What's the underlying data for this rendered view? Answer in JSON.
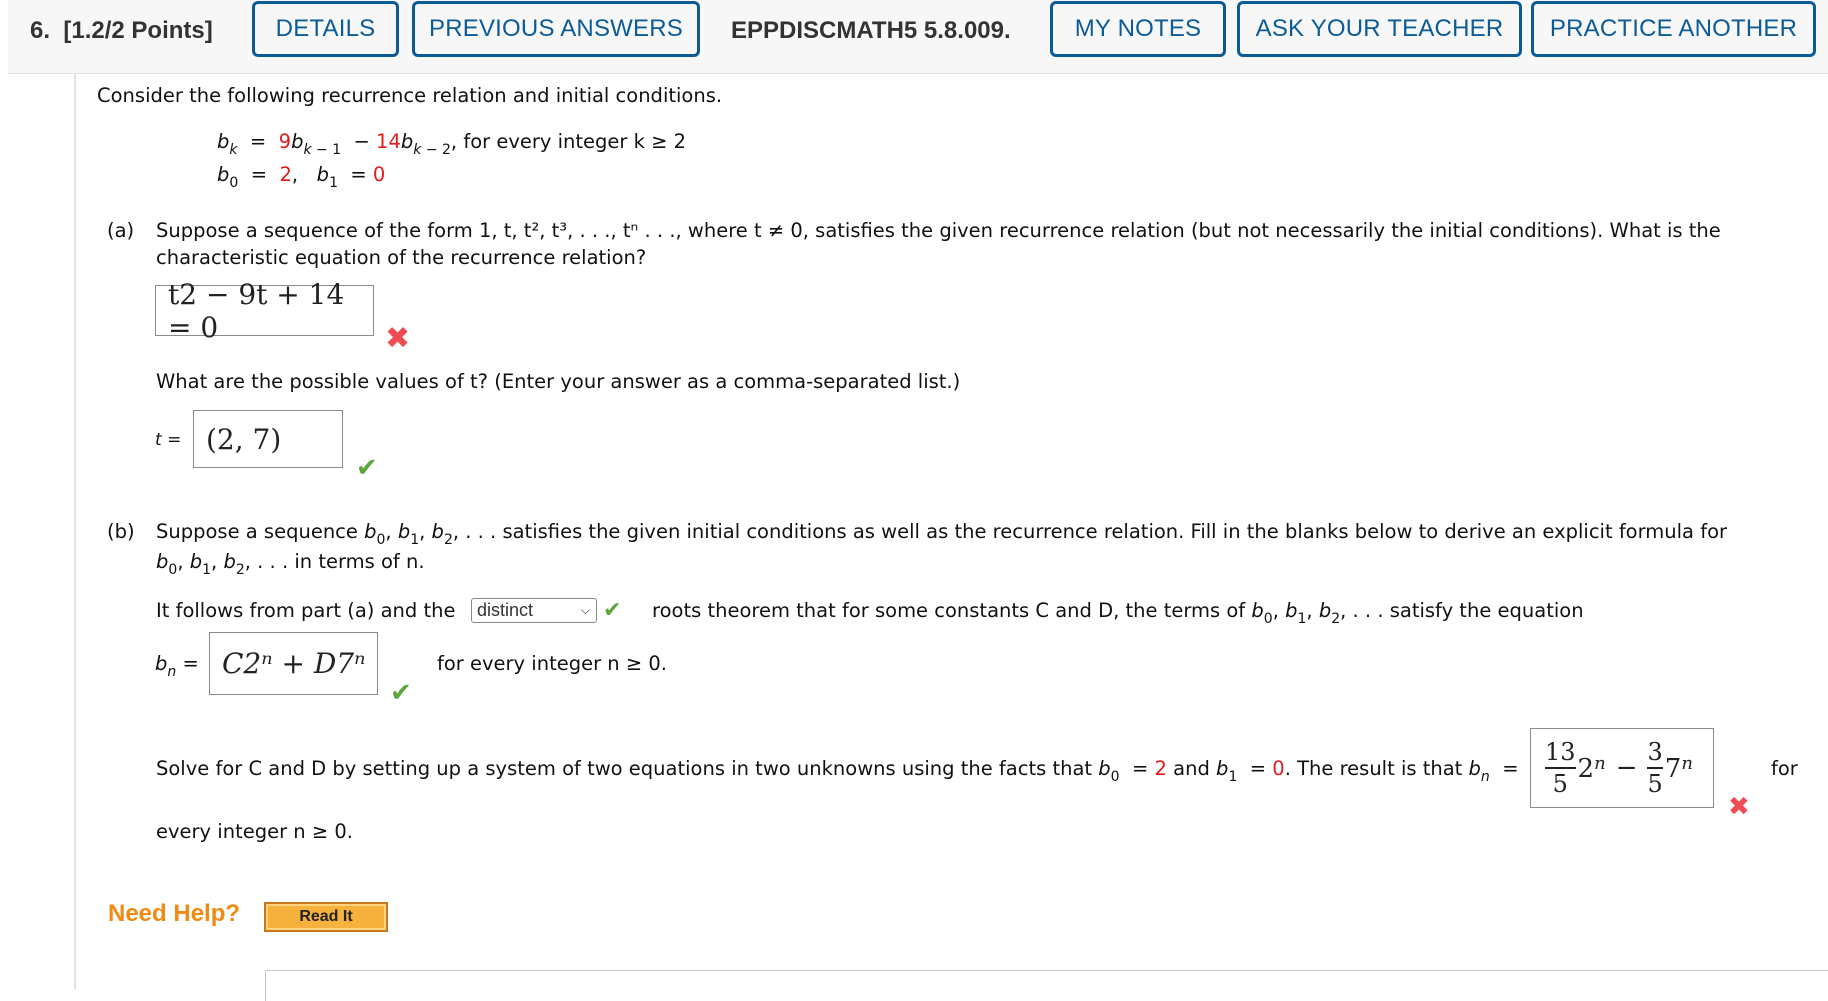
{
  "header": {
    "question_number": "6.",
    "points": "[1.2/2 Points]",
    "buttons": {
      "details": "DETAILS",
      "previous_answers": "PREVIOUS ANSWERS",
      "my_notes": "MY NOTES",
      "ask_teacher": "ASK YOUR TEACHER",
      "practice_another": "PRACTICE ANOTHER"
    },
    "question_id": "EPPDISCMATH5 5.8.009."
  },
  "intro": "Consider the following recurrence relation and initial conditions.",
  "recurrence": {
    "coef1": "9",
    "coef2": "14",
    "condition": "for every integer k ≥ 2",
    "b0_value": "2",
    "b1_value": "0"
  },
  "part_a": {
    "label": "(a)",
    "question_line1": "Suppose a sequence of the form 1, t, t², t³, . . ., tⁿ . . ., where t ≠ 0, satisfies the given recurrence relation (but not necessarily the initial conditions). What is the",
    "question_line2": "characteristic equation of the recurrence relation?",
    "answer1": "t2 − 9t + 14 = 0",
    "answer1_status": "incorrect",
    "question2": "What are the possible values of t? (Enter your answer as a comma-separated list.)",
    "t_label": "t =",
    "answer2": "(2, 7)",
    "answer2_status": "correct"
  },
  "part_b": {
    "label": "(b)",
    "line1_start": "Suppose a sequence",
    "line1_end": "satisfies the given initial conditions as well as the recurrence relation. Fill in the blanks below to derive an explicit formula for",
    "line2_end": "in terms of n.",
    "follows_prefix": "It follows from part (a) and the",
    "select_value": "distinct",
    "select_status": "correct",
    "follows_suffix": "roots theorem that for some constants C and D, the terms of",
    "follows_end": "satisfy the equation",
    "bn_answer": "C2ⁿ + D7ⁿ",
    "bn_status": "correct",
    "bn_suffix": "for every integer n ≥ 0.",
    "solve_text": "Solve for C and D by setting up a system of two equations in two unknowns using the facts that",
    "solve_b0": "2",
    "solve_b1": "0",
    "result_text": ". The result is that",
    "final_answer": {
      "c_num": "13",
      "c_den": "5",
      "d_num": "3",
      "d_den": "5"
    },
    "final_status": "incorrect",
    "for_text": "for",
    "every_text": "every integer n ≥ 0."
  },
  "help": {
    "label": "Need Help?",
    "read_it": "Read It"
  }
}
